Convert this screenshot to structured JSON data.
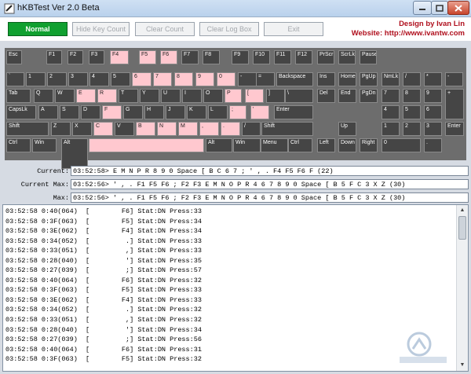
{
  "window": {
    "title": "hKBTest Ver 2.0 Beta"
  },
  "toolbar": {
    "normal": "Normal",
    "hide_key_count": "Hide Key Count",
    "clear_count": "Clear Count",
    "clear_log_box": "Clear Log Box",
    "exit": "Exit"
  },
  "credits": {
    "line1": "Design by Ivan Lin",
    "line2": "Website: http://www.ivantw.com"
  },
  "keyboard_keys": [
    {
      "label": "Esc",
      "hit": false
    },
    {
      "label": "F1",
      "hit": false
    },
    {
      "label": "F2",
      "hit": false
    },
    {
      "label": "F3",
      "hit": false
    },
    {
      "label": "F4",
      "hit": true
    },
    {
      "label": "F5",
      "hit": true
    },
    {
      "label": "F6",
      "hit": true
    },
    {
      "label": "F7",
      "hit": false
    },
    {
      "label": "F8",
      "hit": false
    },
    {
      "label": "F9",
      "hit": false
    },
    {
      "label": "F10",
      "hit": false
    },
    {
      "label": "F11",
      "hit": false
    },
    {
      "label": "F12",
      "hit": false
    },
    {
      "label": "PrScr",
      "hit": false
    },
    {
      "label": "ScrLk",
      "hit": false
    },
    {
      "label": "Pause",
      "hit": false
    },
    {
      "label": "`",
      "hit": false
    },
    {
      "label": "1",
      "hit": false
    },
    {
      "label": "2",
      "hit": false
    },
    {
      "label": "3",
      "hit": false
    },
    {
      "label": "4",
      "hit": false
    },
    {
      "label": "5",
      "hit": false
    },
    {
      "label": "6",
      "hit": true
    },
    {
      "label": "7",
      "hit": true
    },
    {
      "label": "8",
      "hit": true
    },
    {
      "label": "9",
      "hit": true
    },
    {
      "label": "0",
      "hit": true
    },
    {
      "label": "-",
      "hit": false
    },
    {
      "label": "=",
      "hit": false
    },
    {
      "label": "Backspace",
      "hit": false
    },
    {
      "label": "Ins",
      "hit": false
    },
    {
      "label": "Home",
      "hit": false
    },
    {
      "label": "PgUp",
      "hit": false
    },
    {
      "label": "NmLk",
      "hit": false
    },
    {
      "label": "/",
      "hit": false
    },
    {
      "label": "*",
      "hit": false
    },
    {
      "label": "-",
      "hit": false
    },
    {
      "label": "Tab",
      "hit": false
    },
    {
      "label": "Q",
      "hit": false
    },
    {
      "label": "W",
      "hit": false
    },
    {
      "label": "E",
      "hit": true
    },
    {
      "label": "R",
      "hit": true
    },
    {
      "label": "T",
      "hit": false
    },
    {
      "label": "Y",
      "hit": false
    },
    {
      "label": "U",
      "hit": false
    },
    {
      "label": "I",
      "hit": false
    },
    {
      "label": "O",
      "hit": false
    },
    {
      "label": "P",
      "hit": true
    },
    {
      "label": "[",
      "hit": true
    },
    {
      "label": "]",
      "hit": false
    },
    {
      "label": "\\",
      "hit": false
    },
    {
      "label": "Del",
      "hit": false
    },
    {
      "label": "End",
      "hit": false
    },
    {
      "label": "PgDn",
      "hit": false
    },
    {
      "label": "7",
      "hit": false
    },
    {
      "label": "8",
      "hit": false
    },
    {
      "label": "9",
      "hit": false
    },
    {
      "label": "+",
      "hit": false
    },
    {
      "label": "CapsLk",
      "hit": false
    },
    {
      "label": "A",
      "hit": false
    },
    {
      "label": "S",
      "hit": false
    },
    {
      "label": "D",
      "hit": false
    },
    {
      "label": "F",
      "hit": true
    },
    {
      "label": "G",
      "hit": false
    },
    {
      "label": "H",
      "hit": false
    },
    {
      "label": "J",
      "hit": false
    },
    {
      "label": "K",
      "hit": false
    },
    {
      "label": "L",
      "hit": false
    },
    {
      "label": ";",
      "hit": true
    },
    {
      "label": "'",
      "hit": true
    },
    {
      "label": "Enter",
      "hit": false
    },
    {
      "label": "4",
      "hit": false
    },
    {
      "label": "5",
      "hit": false
    },
    {
      "label": "6",
      "hit": false
    },
    {
      "label": "Shift",
      "hit": false
    },
    {
      "label": "Z",
      "hit": false
    },
    {
      "label": "X",
      "hit": false
    },
    {
      "label": "C",
      "hit": true
    },
    {
      "label": "V",
      "hit": false
    },
    {
      "label": "B",
      "hit": true
    },
    {
      "label": "N",
      "hit": true
    },
    {
      "label": "M",
      "hit": true
    },
    {
      "label": ",",
      "hit": true
    },
    {
      "label": ".",
      "hit": true
    },
    {
      "label": "/",
      "hit": false
    },
    {
      "label": "Shift",
      "hit": false
    },
    {
      "label": "Up",
      "hit": false
    },
    {
      "label": "1",
      "hit": false
    },
    {
      "label": "2",
      "hit": false
    },
    {
      "label": "3",
      "hit": false
    },
    {
      "label": "Enter",
      "hit": false
    },
    {
      "label": "Ctrl",
      "hit": false
    },
    {
      "label": "Win",
      "hit": false
    },
    {
      "label": "Alt",
      "hit": false
    },
    {
      "label": "",
      "hit": true
    },
    {
      "label": "Alt",
      "hit": false
    },
    {
      "label": "Win",
      "hit": false
    },
    {
      "label": "Menu",
      "hit": false
    },
    {
      "label": "Ctrl",
      "hit": false
    },
    {
      "label": "Left",
      "hit": false
    },
    {
      "label": "Down",
      "hit": false
    },
    {
      "label": "Right",
      "hit": false
    },
    {
      "label": "0",
      "hit": false
    },
    {
      "label": ".",
      "hit": false
    }
  ],
  "status": {
    "current_label": "Current:",
    "current_value": "03:52:58> E M N P R 8 9 0 Space [ B C 6 7 ; ' , . F4 F5 F6 F (22)",
    "current_max_label": "Current Max:",
    "current_max_value": "03:52:56> ' , . F1 F5 F6 ; F2 F3 E M N O P R 4 6 7 8 9 0 Space [ B 5 F C 3 X Z (30)",
    "max_label": "Max:",
    "max_value": "03:52:56> ' , . F1 F5 F6 ; F2 F3 E M N O P R 4 6 7 8 9 0 Space [ B 5 F C 3 X Z (30)"
  },
  "log": [
    "03:52:58 0:40(064)  [        F6] Stat:DN Press:33",
    "03:52:58 0:3F(063)  [        F5] Stat:DN Press:34",
    "03:52:58 0:3E(062)  [        F4] Stat:DN Press:34",
    "03:52:58 0:34(052)  [         .] Stat:DN Press:33",
    "03:52:58 0:33(051)  [         ,] Stat:DN Press:33",
    "03:52:58 0:28(040)  [         '] Stat:DN Press:35",
    "03:52:58 0:27(039)  [         ;] Stat:DN Press:57",
    "03:52:58 0:40(064)  [        F6] Stat:DN Press:32",
    "03:52:58 0:3F(063)  [        F5] Stat:DN Press:33",
    "03:52:58 0:3E(062)  [        F4] Stat:DN Press:33",
    "03:52:58 0:34(052)  [         .] Stat:DN Press:32",
    "03:52:58 0:33(051)  [         ,] Stat:DN Press:32",
    "03:52:58 0:28(040)  [         '] Stat:DN Press:34",
    "03:52:58 0:27(039)  [         ;] Stat:DN Press:56",
    "03:52:58 0:40(064)  [        F6] Stat:DN Press:31",
    "03:52:58 0:3F(063)  [        F5] Stat:DN Press:32"
  ]
}
